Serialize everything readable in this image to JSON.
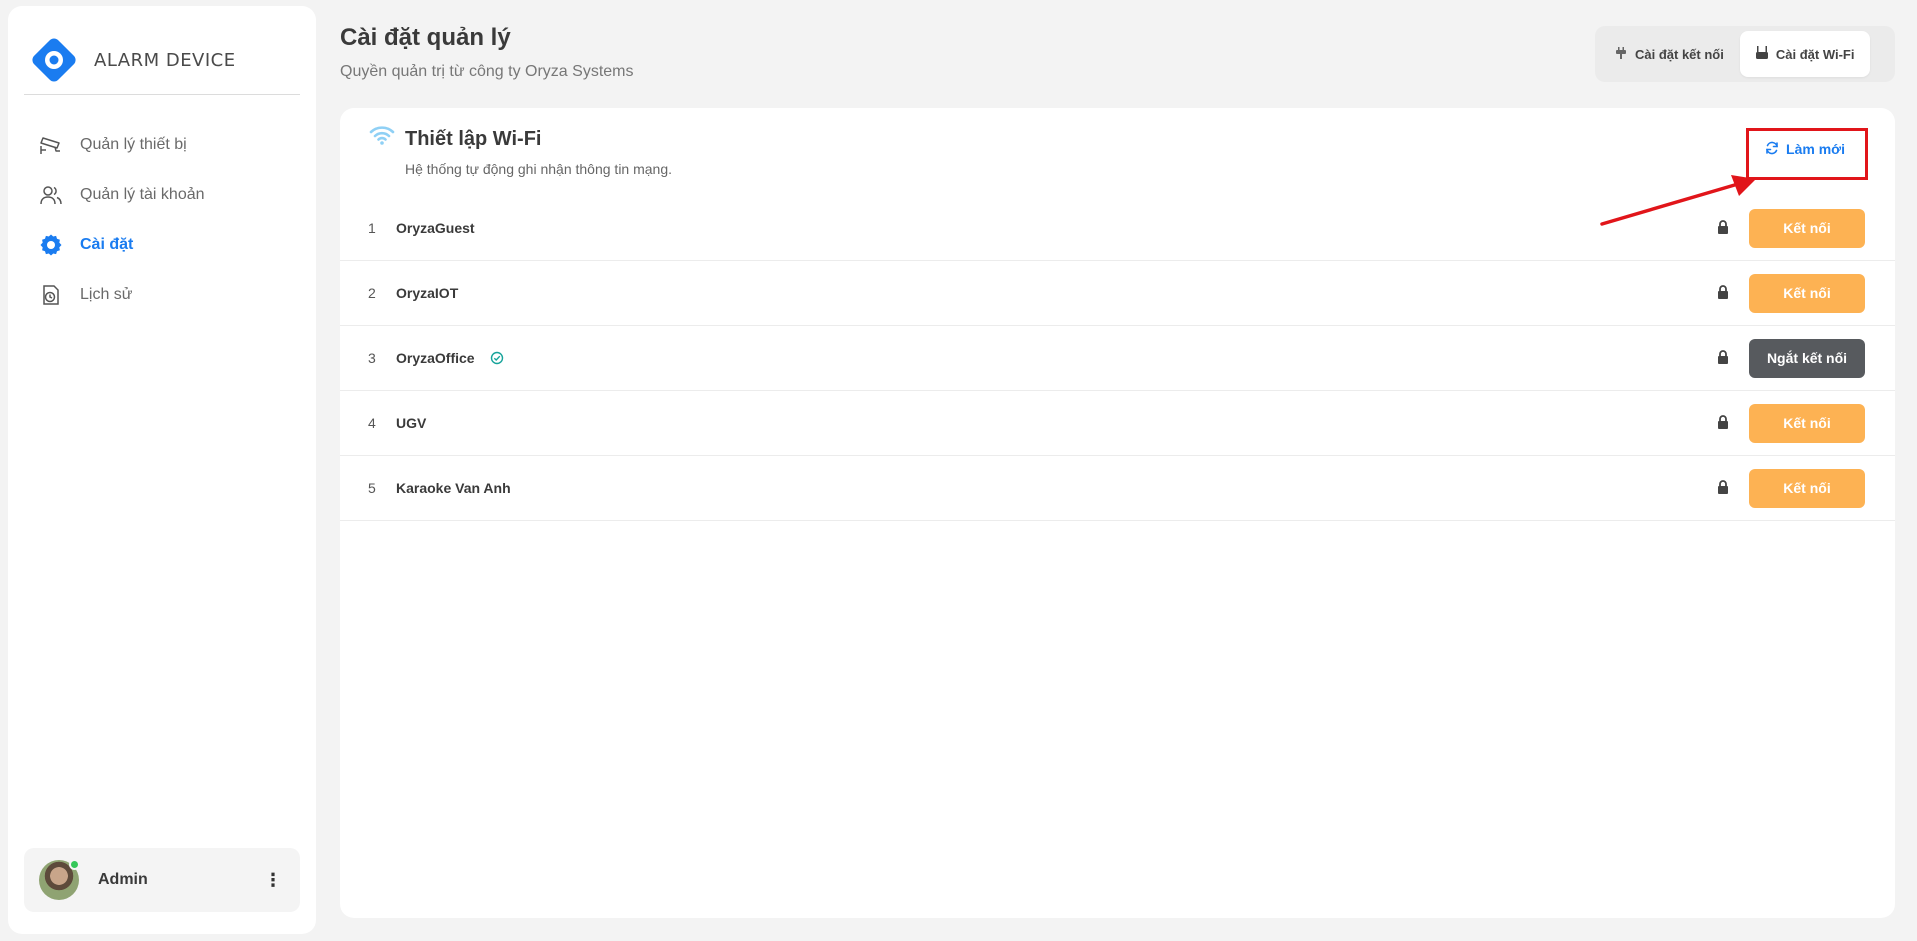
{
  "brand": {
    "name": "ALARM DEVICE",
    "accent": "#1a7cf0"
  },
  "sidebar": {
    "items": [
      {
        "label": "Quản lý thiết bị",
        "icon": "cctv-camera-icon",
        "active": false
      },
      {
        "label": "Quản lý tài khoản",
        "icon": "users-icon",
        "active": false
      },
      {
        "label": "Cài đặt",
        "icon": "gear-icon",
        "active": true
      },
      {
        "label": "Lịch sử",
        "icon": "history-icon",
        "active": false
      }
    ],
    "user": {
      "name": "Admin",
      "status": "online"
    }
  },
  "header": {
    "title": "Cài đặt quản lý",
    "subtitle": "Quyền quản trị từ công ty Oryza Systems",
    "tabs": [
      {
        "label": "Cài đặt kết nối",
        "icon": "plug-icon",
        "active": false
      },
      {
        "label": "Cài đặt Wi-Fi",
        "icon": "router-icon",
        "active": true
      }
    ]
  },
  "panel": {
    "title": "Thiết lập Wi-Fi",
    "subtitle": "Hệ thống tự động ghi nhận thông tin mạng.",
    "refresh_label": "Làm mới",
    "networks": [
      {
        "index": "1",
        "ssid": "OryzaGuest",
        "connected": false,
        "action": "Kết nối"
      },
      {
        "index": "2",
        "ssid": "OryzaIOT",
        "connected": false,
        "action": "Kết nối"
      },
      {
        "index": "3",
        "ssid": "OryzaOffice",
        "connected": true,
        "action": "Ngắt kết nối"
      },
      {
        "index": "4",
        "ssid": "UGV",
        "connected": false,
        "action": "Kết nối"
      },
      {
        "index": "5",
        "ssid": "Karaoke Van Anh",
        "connected": false,
        "action": "Kết nối"
      }
    ]
  },
  "colors": {
    "connect": "#fdb253",
    "disconnect": "#575a5e",
    "highlight": "#e1151a",
    "connected_check": "#16a39a"
  }
}
